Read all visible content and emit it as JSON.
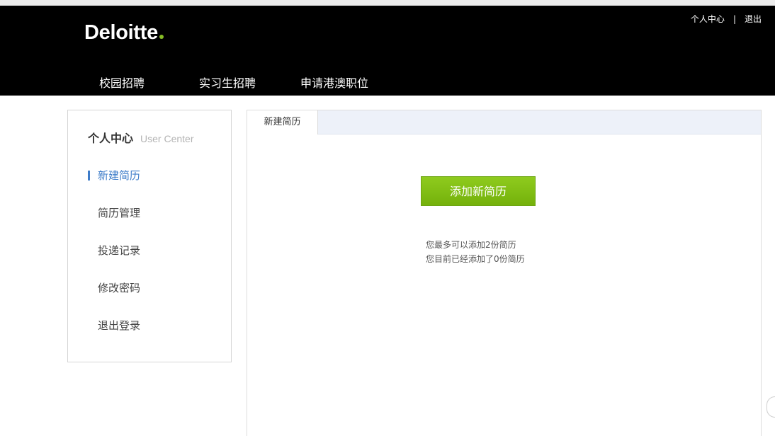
{
  "header": {
    "logo_text": "Deloitte",
    "brand_dot_color": "#86bc25",
    "user_center_link": "个人中心",
    "separator": "|",
    "logout_link": "退出",
    "nav": [
      "校园招聘",
      "实习生招聘",
      "申请港澳职位"
    ]
  },
  "sidebar": {
    "title_cn": "个人中心",
    "title_en": "User Center",
    "items": [
      {
        "label": "新建简历",
        "active": true
      },
      {
        "label": "简历管理",
        "active": false
      },
      {
        "label": "投递记录",
        "active": false
      },
      {
        "label": "修改密码",
        "active": false
      },
      {
        "label": "退出登录",
        "active": false
      }
    ],
    "active_color": "#3d7cc9"
  },
  "main": {
    "tab_label": "新建简历",
    "add_button_label": "添加新简历",
    "button_color": "#80bd17",
    "info_lines": [
      "您最多可以添加2份简历",
      "您目前已经添加了0份简历"
    ]
  }
}
